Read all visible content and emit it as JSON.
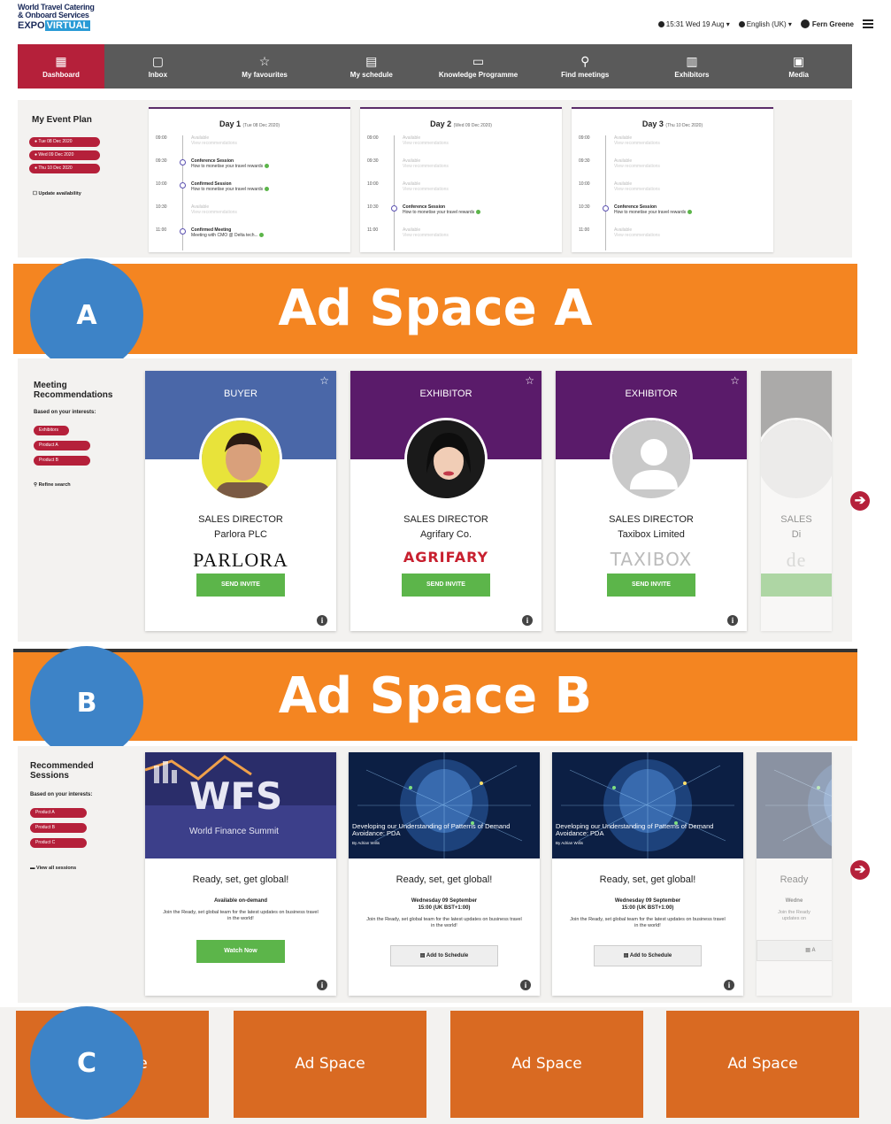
{
  "logo": {
    "line1": "World Travel Catering",
    "line2": "& Onboard Services",
    "expo": "EXPO",
    "virtual": "VIRTUAL"
  },
  "topbar": {
    "clock": "15:31 Wed 19 Aug ▾",
    "language": "English (UK) ▾",
    "user": "Fern Greene"
  },
  "nav": [
    {
      "label": "Dashboard",
      "icon": "grid-icon",
      "glyph": "▦"
    },
    {
      "label": "Inbox",
      "icon": "inbox-icon",
      "glyph": "▢"
    },
    {
      "label": "My favourites",
      "icon": "star-icon",
      "glyph": "☆"
    },
    {
      "label": "My schedule",
      "icon": "calendar-icon",
      "glyph": "▤"
    },
    {
      "label": "Knowledge Programme",
      "icon": "video-icon",
      "glyph": "▭"
    },
    {
      "label": "Find meetings",
      "icon": "search-icon",
      "glyph": "⚲"
    },
    {
      "label": "Exhibitors",
      "icon": "building-icon",
      "glyph": "▥"
    },
    {
      "label": "Media",
      "icon": "media-icon",
      "glyph": "▣"
    }
  ],
  "event_plan": {
    "title": "My Event Plan",
    "days": [
      "Tue 08 Dec 2020",
      "Wed 09 Dec 2020",
      "Thu 10 Dec 2020"
    ],
    "update": "Update availability",
    "cards": [
      {
        "title": "Day 1",
        "date": "(Tue 08 Dec 2020)",
        "slots": [
          {
            "time": "09:00",
            "head": "Available",
            "sub": "View recommendations",
            "active": false
          },
          {
            "time": "09:30",
            "head": "Conference Session",
            "sub": "How to monetise your travel rewards",
            "active": true
          },
          {
            "time": "10:00",
            "head": "Confirmed Session",
            "sub": "How to monetise your travel rewards",
            "active": true
          },
          {
            "time": "10:30",
            "head": "Available",
            "sub": "View recommendations",
            "active": false
          },
          {
            "time": "11:00",
            "head": "Confirmed Meeting",
            "sub": "Meeting with CMO @ Delta tech...",
            "active": true
          }
        ]
      },
      {
        "title": "Day 2",
        "date": "(Wed 09 Dec 2020)",
        "slots": [
          {
            "time": "09:00",
            "head": "Available",
            "sub": "View recommendations",
            "active": false
          },
          {
            "time": "09:30",
            "head": "Available",
            "sub": "View recommendations",
            "active": false
          },
          {
            "time": "10:00",
            "head": "Available",
            "sub": "View recommendations",
            "active": false
          },
          {
            "time": "10:30",
            "head": "Conference Session",
            "sub": "How to monetise your travel rewards",
            "active": true
          },
          {
            "time": "11:00",
            "head": "Available",
            "sub": "View recommendations",
            "active": false
          }
        ]
      },
      {
        "title": "Day 3",
        "date": "(Thu 10 Dec 2020)",
        "slots": [
          {
            "time": "09:00",
            "head": "Available",
            "sub": "View recommendations",
            "active": false
          },
          {
            "time": "09:30",
            "head": "Available",
            "sub": "View recommendations",
            "active": false
          },
          {
            "time": "10:00",
            "head": "Available",
            "sub": "View recommendations",
            "active": false
          },
          {
            "time": "10:30",
            "head": "Conference Session",
            "sub": "How to monetise your travel rewards",
            "active": true
          },
          {
            "time": "11:00",
            "head": "Available",
            "sub": "View recommendations",
            "active": false
          }
        ]
      }
    ]
  },
  "ad_a": {
    "letter": "A",
    "label": "Ad Space A"
  },
  "ad_b": {
    "letter": "B",
    "label": "Ad Space B"
  },
  "ad_c": {
    "letter": "C",
    "boxes": [
      "Ad Space",
      "Ad Space",
      "Ad Space",
      "Ad Space"
    ]
  },
  "meetings": {
    "title_line1": "Meeting",
    "title_line2": "Recommendations",
    "based": "Based on your interests:",
    "tags": [
      "Exhibitors",
      "Product A",
      "Product B"
    ],
    "refine": "Refine search",
    "cards": [
      {
        "type": "BUYER",
        "role": "SALES DIRECTOR",
        "company": "Parlora PLC",
        "brand": "PARLORA",
        "button": "SEND INVITE",
        "color": "#4a67a8"
      },
      {
        "type": "EXHIBITOR",
        "role": "SALES DIRECTOR",
        "company": "Agrifary Co.",
        "brand": "AGRIFARY",
        "button": "SEND INVITE",
        "color": "#5a1b6a"
      },
      {
        "type": "EXHIBITOR",
        "role": "SALES DIRECTOR",
        "company": "Taxibox Limited",
        "brand": "TAXIBOX",
        "button": "SEND INVITE",
        "color": "#5a1b6a"
      },
      {
        "type": "",
        "role": "SALES",
        "company": "Di",
        "brand": "de",
        "button": "",
        "color": "#555555"
      }
    ]
  },
  "sessions": {
    "title_line1": "Recommended",
    "title_line2": "Sessions",
    "based": "Based on your interests:",
    "tags": [
      "Product A",
      "Product B",
      "Product C"
    ],
    "view_all": "View all sessions",
    "cards": [
      {
        "img_title": "WFS",
        "img_sub": "World Finance Summit",
        "title": "Ready, set, get global!",
        "date1": "Available on-demand",
        "date2": "",
        "desc": "Join the Ready, set global team for the latest updates on business travel in the world!",
        "button": "Watch Now"
      },
      {
        "img_title": "Developing our Understanding of Patterns of Demand Avoidance: PDA",
        "img_sub": "By Adrian Willis",
        "title": "Ready, set, get global!",
        "date1": "Wednesday 09 September",
        "date2": "15:00 (UK BST+1:00)",
        "desc": "Join the Ready, set global team for the latest updates on business travel in the world!",
        "button": "Add to Schedule"
      },
      {
        "img_title": "Developing our Understanding of Patterns of Demand Avoidance: PDA",
        "img_sub": "By Adrian Willis",
        "title": "Ready, set, get global!",
        "date1": "Wednesday 09 September",
        "date2": "15:00 (UK BST+1:00)",
        "desc": "Join the Ready, set global team for the latest updates on business travel in the world!",
        "button": "Add to Schedule"
      },
      {
        "img_title": "",
        "img_sub": "",
        "title": "Ready",
        "date1": "Wedne",
        "date2": "",
        "desc": "Join the Ready updates on",
        "button": "A"
      }
    ]
  },
  "colors": {
    "brand_red": "#b5203a",
    "nav_grey": "#5a5a5a",
    "ad_orange": "#f48521",
    "badge_blue": "#3d83c7",
    "green": "#5cb54a",
    "purple": "#5a1b6a"
  }
}
